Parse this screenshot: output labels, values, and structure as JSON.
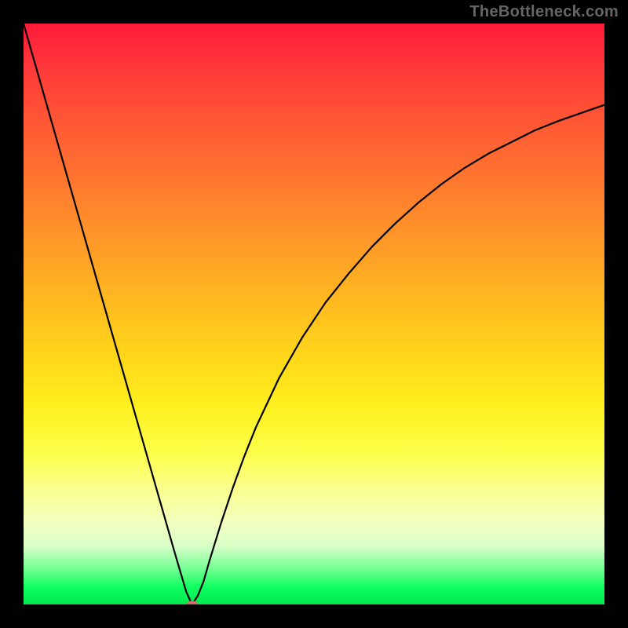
{
  "watermark": "TheBottleneck.com",
  "colors": {
    "page_bg": "#000000",
    "curve": "#000000",
    "marker": "#cc6f6a",
    "watermark_text": "#666666"
  },
  "chart_data": {
    "type": "line",
    "title": "",
    "xlabel": "",
    "ylabel": "",
    "xlim": [
      0,
      100
    ],
    "ylim": [
      0,
      100
    ],
    "grid": false,
    "legend": false,
    "x": [
      0,
      2,
      4,
      6,
      8,
      10,
      12,
      14,
      16,
      18,
      20,
      22,
      24,
      26,
      28,
      29,
      30,
      31,
      32,
      34,
      36,
      38,
      40,
      44,
      48,
      52,
      56,
      60,
      64,
      68,
      72,
      76,
      80,
      84,
      88,
      92,
      96,
      100
    ],
    "values": [
      100,
      93,
      86,
      79,
      72,
      65,
      58,
      51,
      44,
      37,
      30,
      23,
      16,
      9,
      2.2,
      0,
      1.5,
      4,
      7.5,
      14,
      20,
      25.5,
      30.5,
      39,
      46,
      52,
      57,
      61.6,
      65.6,
      69.2,
      72.4,
      75.2,
      77.6,
      79.6,
      81.6,
      83.2,
      84.6,
      86
    ],
    "min_point": {
      "x": 29,
      "y": 0
    }
  }
}
